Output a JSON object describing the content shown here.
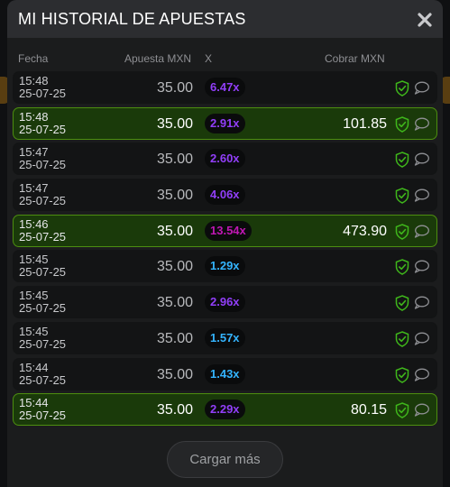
{
  "modal": {
    "title": "MI HISTORIAL DE APUESTAS",
    "close_icon": "close-icon"
  },
  "columns": {
    "fecha": "Fecha",
    "apuesta": "Apuesta MXN",
    "x": "X",
    "cobrar": "Cobrar MXN"
  },
  "colors": {
    "win_bg": "#1a3a0a",
    "win_border": "#4d8e10",
    "mult_blue": "#34b4ff",
    "mult_purple": "#913ef8",
    "mult_pink": "#c017b4",
    "shield_green": "#3fb71b"
  },
  "bets": [
    {
      "time": "15:48",
      "date": "25-07-25",
      "amount": "35.00",
      "multiplier": "6.47x",
      "mult_color": "#913ef8",
      "cashout": "",
      "win": false
    },
    {
      "time": "15:48",
      "date": "25-07-25",
      "amount": "35.00",
      "multiplier": "2.91x",
      "mult_color": "#913ef8",
      "cashout": "101.85",
      "win": true
    },
    {
      "time": "15:47",
      "date": "25-07-25",
      "amount": "35.00",
      "multiplier": "2.60x",
      "mult_color": "#913ef8",
      "cashout": "",
      "win": false
    },
    {
      "time": "15:47",
      "date": "25-07-25",
      "amount": "35.00",
      "multiplier": "4.06x",
      "mult_color": "#913ef8",
      "cashout": "",
      "win": false
    },
    {
      "time": "15:46",
      "date": "25-07-25",
      "amount": "35.00",
      "multiplier": "13.54x",
      "mult_color": "#c017b4",
      "cashout": "473.90",
      "win": true
    },
    {
      "time": "15:45",
      "date": "25-07-25",
      "amount": "35.00",
      "multiplier": "1.29x",
      "mult_color": "#34b4ff",
      "cashout": "",
      "win": false
    },
    {
      "time": "15:45",
      "date": "25-07-25",
      "amount": "35.00",
      "multiplier": "2.96x",
      "mult_color": "#913ef8",
      "cashout": "",
      "win": false
    },
    {
      "time": "15:45",
      "date": "25-07-25",
      "amount": "35.00",
      "multiplier": "1.57x",
      "mult_color": "#34b4ff",
      "cashout": "",
      "win": false
    },
    {
      "time": "15:44",
      "date": "25-07-25",
      "amount": "35.00",
      "multiplier": "1.43x",
      "mult_color": "#34b4ff",
      "cashout": "",
      "win": false
    },
    {
      "time": "15:44",
      "date": "25-07-25",
      "amount": "35.00",
      "multiplier": "2.29x",
      "mult_color": "#913ef8",
      "cashout": "80.15",
      "win": true
    }
  ],
  "row_icons": {
    "shield": "provably-fair-shield-icon",
    "chat": "chat-bubble-icon"
  },
  "load_more": "Cargar más"
}
